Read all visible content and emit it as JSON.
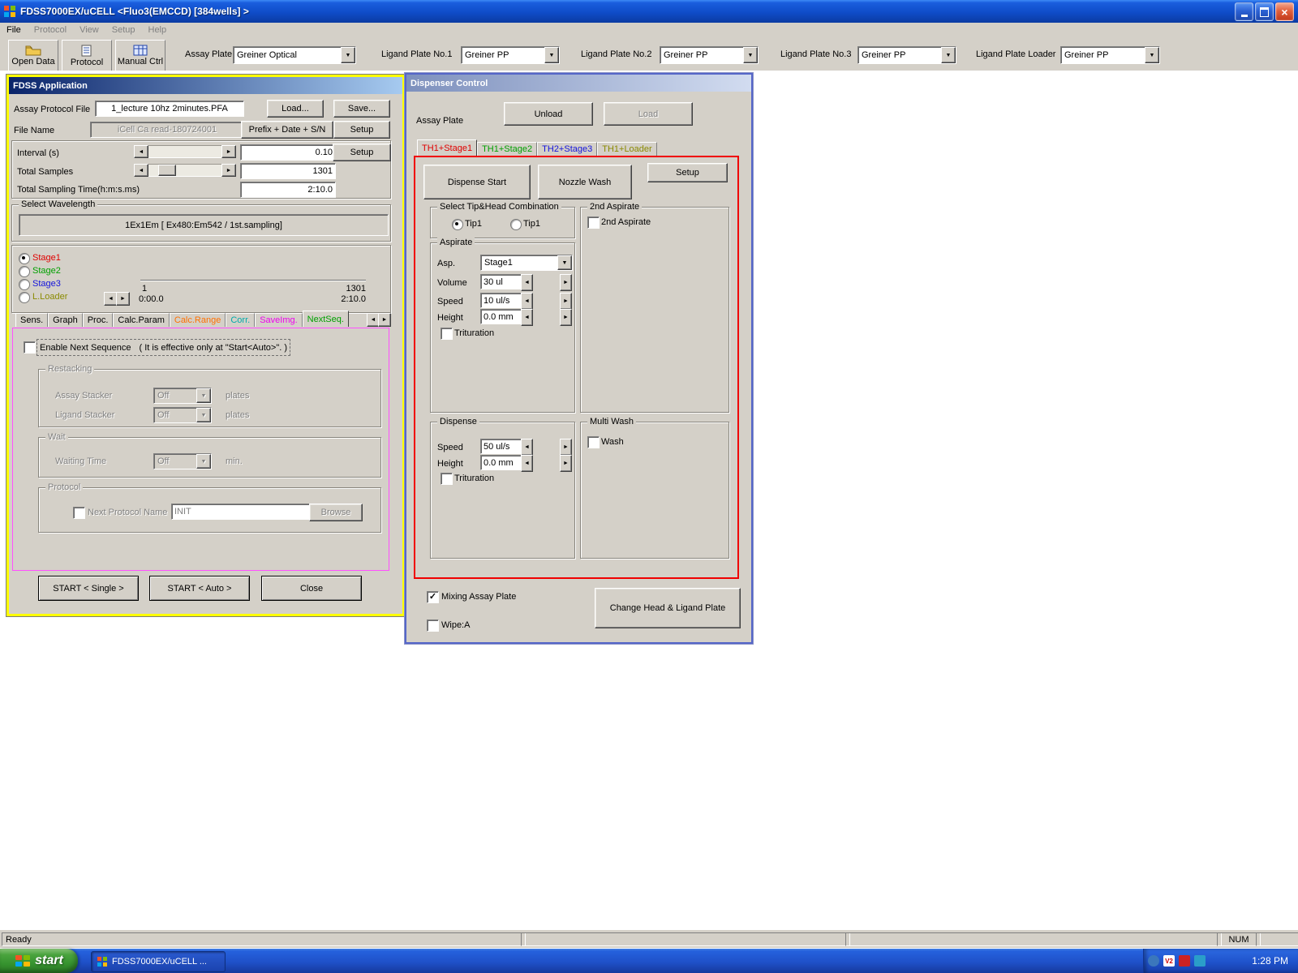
{
  "icons": {
    "left": "◄",
    "right": "►",
    "down": "▼",
    "up": "▲",
    "check": "✓",
    "close": "×"
  },
  "titlebar": {
    "title": "FDSS7000EX/uCELL  <Fluo3(EMCCD) [384wells] >"
  },
  "menu": [
    "File",
    "Protocol",
    "View",
    "Setup",
    "Help"
  ],
  "toolbar": {
    "buttons": [
      {
        "label": "Open Data"
      },
      {
        "label": "Protocol"
      },
      {
        "label": "Manual Ctrl"
      }
    ],
    "plates": [
      {
        "label": "Assay Plate",
        "value": "Greiner Optical"
      },
      {
        "label": "Ligand Plate No.1",
        "value": "Greiner PP"
      },
      {
        "label": "Ligand Plate No.2",
        "value": "Greiner PP"
      },
      {
        "label": "Ligand Plate No.3",
        "value": "Greiner PP"
      },
      {
        "label": "Ligand Plate Loader",
        "value": "Greiner PP"
      }
    ]
  },
  "fdss": {
    "title": "FDSS Application",
    "protocol_file": {
      "label": "Assay Protocol File",
      "value": "1_lecture 10hz 2minutes.PFA",
      "load": "Load...",
      "save": "Save..."
    },
    "file_name": {
      "label": "File Name",
      "value": "iCell Ca read-180724001",
      "prefix_btn": "Prefix + Date + S/N",
      "setup_btn": "Setup"
    },
    "interval": {
      "label": "Interval (s)",
      "value": "0.10",
      "setup_btn": "Setup"
    },
    "total_samples": {
      "label": "Total Samples",
      "value": "1301"
    },
    "total_time": {
      "label": "Total Sampling Time(h:m:s.ms)",
      "value": "2:10.0"
    },
    "wavelength": {
      "group": "Select Wavelength",
      "value": "1Ex1Em [ Ex480:Em542 / 1st.sampling]"
    },
    "stages": [
      {
        "label": "Stage1"
      },
      {
        "label": "Stage2"
      },
      {
        "label": "Stage3"
      },
      {
        "label": "L.Loader"
      }
    ],
    "range": {
      "sample_start": "1",
      "sample_end": "1301",
      "time_start": "0:00.0",
      "time_end": "2:10.0"
    },
    "tabs": [
      {
        "label": "Sens."
      },
      {
        "label": "Graph"
      },
      {
        "label": "Proc."
      },
      {
        "label": "Calc.Param"
      },
      {
        "label": "Calc.Range"
      },
      {
        "label": "Corr."
      },
      {
        "label": "SaveImg."
      },
      {
        "label": "NextSeq."
      }
    ],
    "nextseq": {
      "enable": "Enable Next Sequence",
      "enable_note": "( It is effective only at \"Start<Auto>\". )",
      "restacking": {
        "group": "Restacking",
        "assay": "Assay Stacker",
        "ligand": "Ligand Stacker",
        "value": "Off",
        "unit": "plates"
      },
      "wait": {
        "group": "Wait",
        "label": "Waiting Time",
        "value": "Off",
        "unit": "min."
      },
      "protocol": {
        "group": "Protocol",
        "label": "Next Protocol Name",
        "value": "INIT",
        "browse": "Browse"
      }
    },
    "start_single": "START < Single >",
    "start_auto": "START < Auto >",
    "close": "Close"
  },
  "dispenser": {
    "title": "Dispenser Control",
    "assay_plate": "Assay Plate",
    "unload": "Unload",
    "load": "Load",
    "tabs": [
      {
        "label": "TH1+Stage1"
      },
      {
        "label": "TH1+Stage2"
      },
      {
        "label": "TH2+Stage3"
      },
      {
        "label": "TH1+Loader"
      }
    ],
    "dispense_start": "Dispense Start",
    "nozzle_wash": "Nozzle Wash",
    "setup": "Setup",
    "tip_head": {
      "group": "Select Tip&Head Combination",
      "tip_a": "Tip1",
      "tip_b": "Tip1"
    },
    "second_aspirate": {
      "group": "2nd Aspirate",
      "check": "2nd Aspirate"
    },
    "aspirate": {
      "group": "Aspirate",
      "asp": "Asp.",
      "asp_value": "Stage1",
      "volume": "Volume",
      "volume_value": "30 ul",
      "speed": "Speed",
      "speed_value": "10 ul/s",
      "height": "Height",
      "height_value": "0.0 mm",
      "trituration": "Trituration"
    },
    "dispense": {
      "group": "Dispense",
      "speed": "Speed",
      "speed_value": "50 ul/s",
      "height": "Height",
      "height_value": "0.0 mm",
      "trituration": "Trituration"
    },
    "multi_wash": {
      "group": "Multi Wash",
      "check": "Wash"
    },
    "mixing": "Mixing Assay Plate",
    "wipe": "Wipe:A",
    "change_head": "Change Head & Ligand Plate"
  },
  "statusbar": {
    "ready": "Ready",
    "num": "NUM"
  },
  "taskbar": {
    "start": "start",
    "task": "FDSS7000EX/uCELL ...",
    "time": "1:28 PM",
    "v2_label": "V2"
  },
  "palette": {
    "stage1": "#e00000",
    "stage2": "#00a000",
    "stage3": "#1414dc",
    "loader": "#8a8a00",
    "tab_calc_range": "#ff7000",
    "tab_corr": "#00aaaa",
    "tab_saveimg": "#ee00ee",
    "tab_nextseq": "#00a000",
    "fdss_window_border": "#ffff00",
    "dispenser_highlight": "#f00000",
    "nextseq_highlight": "#ff50ff",
    "taskbar_blue": "#1f51c9",
    "start_green": "#379430"
  }
}
